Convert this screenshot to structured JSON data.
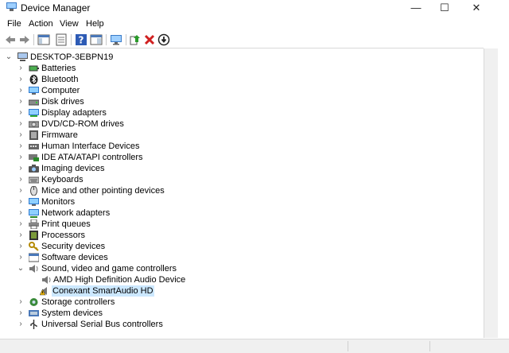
{
  "window": {
    "title": "Device Manager",
    "minimize": "—",
    "maximize": "☐",
    "close": "✕"
  },
  "menu": [
    "File",
    "Action",
    "View",
    "Help"
  ],
  "toolbar": [
    "back-icon",
    "forward-icon",
    "show-hide-console-tree-icon",
    "properties-icon",
    "help-icon",
    "action-pane-icon",
    "scan-hardware-icon",
    "update-driver-icon",
    "uninstall-device-icon",
    "disable-device-icon"
  ],
  "tree": {
    "root": "DESKTOP-3EBPN19",
    "categories": [
      "Batteries",
      "Bluetooth",
      "Computer",
      "Disk drives",
      "Display adapters",
      "DVD/CD-ROM drives",
      "Firmware",
      "Human Interface Devices",
      "IDE ATA/ATAPI controllers",
      "Imaging devices",
      "Keyboards",
      "Mice and other pointing devices",
      "Monitors",
      "Network adapters",
      "Print queues",
      "Processors",
      "Security devices",
      "Software devices",
      "Sound, video and game controllers"
    ],
    "sound_children": [
      "AMD High Definition Audio Device",
      "Conexant SmartAudio HD"
    ],
    "after": [
      "Storage controllers",
      "System devices",
      "Universal Serial Bus controllers"
    ]
  },
  "colors": {
    "selection": "#cce8ff",
    "warning": "#e8b100",
    "error": "#d02020"
  }
}
